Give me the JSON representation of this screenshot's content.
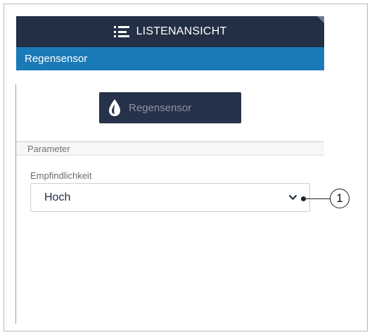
{
  "topbar": {
    "title": "LISTENANSICHT",
    "icon": "list-icon"
  },
  "header": {
    "title": "Regensensor"
  },
  "sensor_button": {
    "label": "Regensensor",
    "icon": "water-drop-icon"
  },
  "parameters": {
    "section_label": "Parameter",
    "sensitivity_label": "Empfindlichkeit",
    "sensitivity_value": "Hoch"
  },
  "callout": {
    "label": "1"
  },
  "colors": {
    "topbar": "#232f44",
    "header": "#1a7ab8",
    "button": "#26324a"
  }
}
